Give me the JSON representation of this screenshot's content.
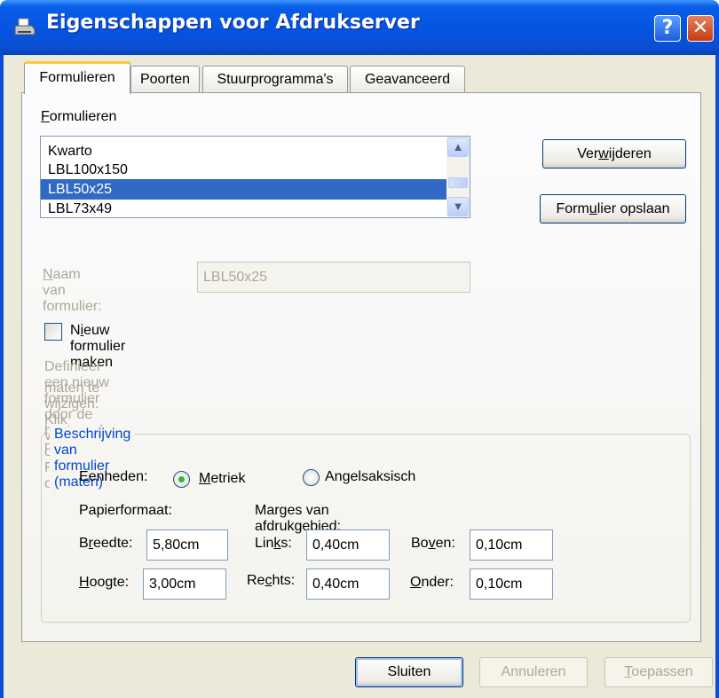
{
  "window": {
    "title": "Eigenschappen voor Afdrukserver",
    "help_label": "?",
    "close_label": "✕"
  },
  "tabs": [
    "Formulieren",
    "Poorten",
    "Stuurprogramma's",
    "Geavanceerd"
  ],
  "forms": {
    "list_label_u": "F",
    "list_label_rest": "ormulieren",
    "items": [
      "Kwarto",
      "LBL100x150",
      "LBL50x25",
      "LBL73x49"
    ],
    "selected": "LBL50x25",
    "delete_pre": "Ver",
    "delete_u": "w",
    "delete_post": "ijderen",
    "save_pre": "Form",
    "save_u": "u",
    "save_post": "lier opslaan"
  },
  "name_field": {
    "label_u": "N",
    "label_rest": "aam van formulier:",
    "value": "LBL50x25"
  },
  "new_form": {
    "label_pre": "N",
    "label_u": "i",
    "label_post": "euw formulier maken",
    "checked": false,
    "hint_line1": "Definieer een nieuw formulier door de bestaande naam en",
    "hint_line2": "maten te wijzigen. Klik vervolgens op Formulier opslaan."
  },
  "description": {
    "group_title": "Beschrijving van formulier (maten)",
    "units_label": "Eenheden:",
    "metric_u": "M",
    "metric_rest": "etriek",
    "anglo_pre": "An",
    "anglo_u": "g",
    "anglo_post": "elsaksisch",
    "selected_unit": "Metriek",
    "paper_size_label": "Papierformaat:",
    "margins_label": "Marges van afdrukgebied:",
    "width_pre": "B",
    "width_u": "r",
    "width_post": "eedte:",
    "width_value": "5,80cm",
    "height_u": "H",
    "height_rest": "oogte:",
    "height_value": "3,00cm",
    "left_pre": "Lin",
    "left_u": "k",
    "left_post": "s:",
    "left_value": "0,40cm",
    "right_pre": "Re",
    "right_u": "c",
    "right_post": "hts:",
    "right_value": "0,40cm",
    "top_pre": "Bo",
    "top_u": "v",
    "top_post": "en:",
    "top_value": "0,10cm",
    "bottom_u": "O",
    "bottom_rest": "nder:",
    "bottom_value": "0,10cm"
  },
  "footer": {
    "close": "Sluiten",
    "cancel": "Annuleren",
    "apply_u": "T",
    "apply_rest": "oepassen"
  },
  "colors": {
    "titlebar": "#0554e3",
    "selection": "#316ac5",
    "group_title": "#0046d5",
    "disabled_text": "#aca899",
    "tab_highlight": "#ffc83c"
  }
}
